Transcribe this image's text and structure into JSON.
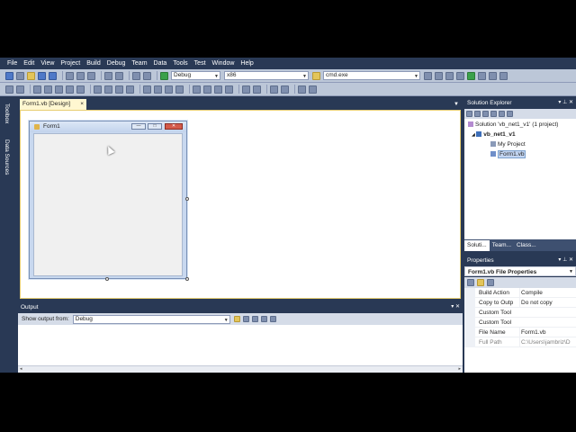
{
  "menubar": [
    "File",
    "Edit",
    "View",
    "Project",
    "Build",
    "Debug",
    "Team",
    "Data",
    "Tools",
    "Test",
    "Window",
    "Help"
  ],
  "toolbar": {
    "config_combo": "Debug",
    "platform_combo": "x86",
    "find_combo": "cmd.exe"
  },
  "left_tabs": {
    "toolbox": "Toolbox",
    "data_sources": "Data Sources"
  },
  "document": {
    "tab_label": "Form1.vb [Design]",
    "tab_close": "×",
    "form_title": "Form1",
    "min": "—",
    "max": "□",
    "close": "✕"
  },
  "output": {
    "title": "Output",
    "show_label": "Show output from:",
    "source": "Debug",
    "pin": "▾ ✕"
  },
  "solution_explorer": {
    "title": "Solution Explorer",
    "pin": "▾ ⊥ ✕",
    "solution": "Solution 'vb_net1_v1' (1 project)",
    "project": "vb_net1_v1",
    "my_project": "My Project",
    "form": "Form1.vb",
    "tabs": [
      "Soluti...",
      "Team...",
      "Class..."
    ]
  },
  "properties": {
    "title": "Properties",
    "pin": "▾ ⊥ ✕",
    "object": "Form1.vb File Properties",
    "rows": [
      {
        "k": "Build Action",
        "v": "Compile",
        "grey": false
      },
      {
        "k": "Copy to Outp",
        "v": "Do not copy",
        "grey": false
      },
      {
        "k": "Custom Tool",
        "v": "",
        "grey": false
      },
      {
        "k": "Custom Tool",
        "v": "",
        "grey": false
      },
      {
        "k": "File Name",
        "v": "Form1.vb",
        "grey": false
      },
      {
        "k": "Full Path",
        "v": "C:\\Users\\jambriz\\D",
        "grey": true
      }
    ]
  },
  "colors": {
    "ide_background": "#293955",
    "active_tab": "#fff7d1",
    "toolbar": "#bcc7d8"
  }
}
